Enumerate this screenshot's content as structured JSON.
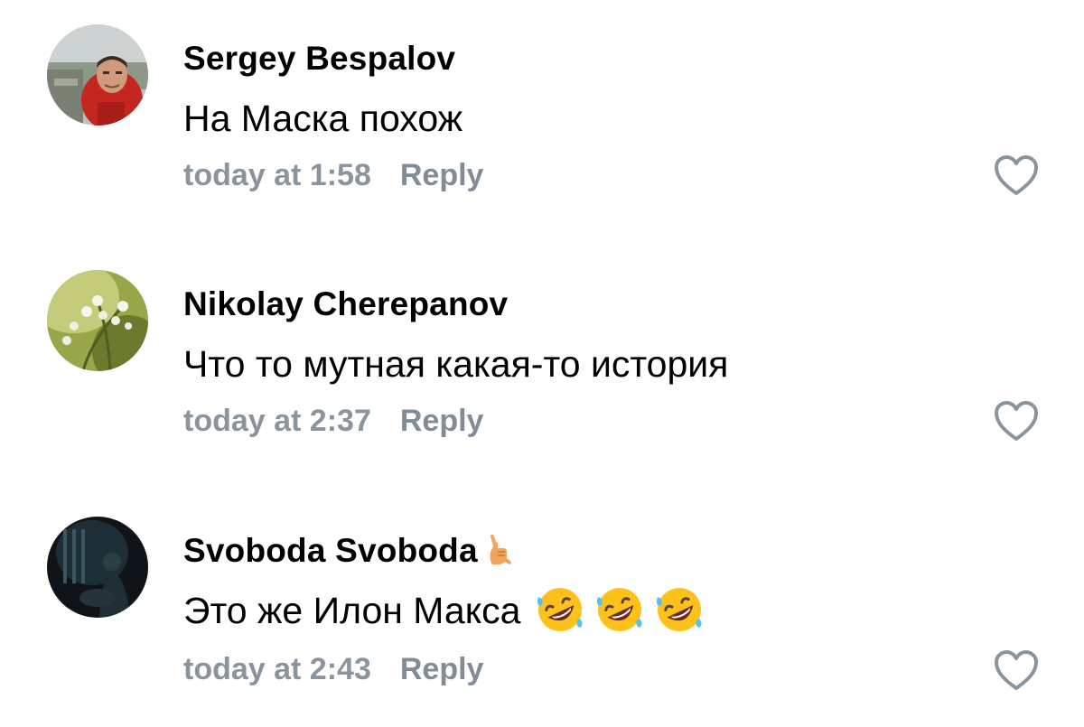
{
  "comments": [
    {
      "author": "Sergey Bespalov",
      "text": "На Маска похож",
      "time": "today at 1:58",
      "reply_label": "Reply",
      "avatar_icon": "man-photo-avatar",
      "author_emoji": "",
      "text_emojis": []
    },
    {
      "author": "Nikolay Cherepanov",
      "text": "Что то мутная какая-то история",
      "time": "today at 2:37",
      "reply_label": "Reply",
      "avatar_icon": "lily-of-the-valley-avatar",
      "author_emoji": "",
      "text_emojis": []
    },
    {
      "author": "Svoboda Svoboda",
      "text": "Это же Илон Макса",
      "time": "today at 2:43",
      "reply_label": "Reply",
      "avatar_icon": "dark-figure-avatar",
      "author_emoji": "call-me-hand-emoji",
      "text_emojis": [
        "rolling-on-floor-laughing-emoji",
        "rolling-on-floor-laughing-emoji",
        "rolling-on-floor-laughing-emoji"
      ]
    }
  ],
  "colors": {
    "meta": "#8a949e",
    "reply": "#818c99",
    "like_stroke": "#8a949e",
    "text": "#000000"
  }
}
